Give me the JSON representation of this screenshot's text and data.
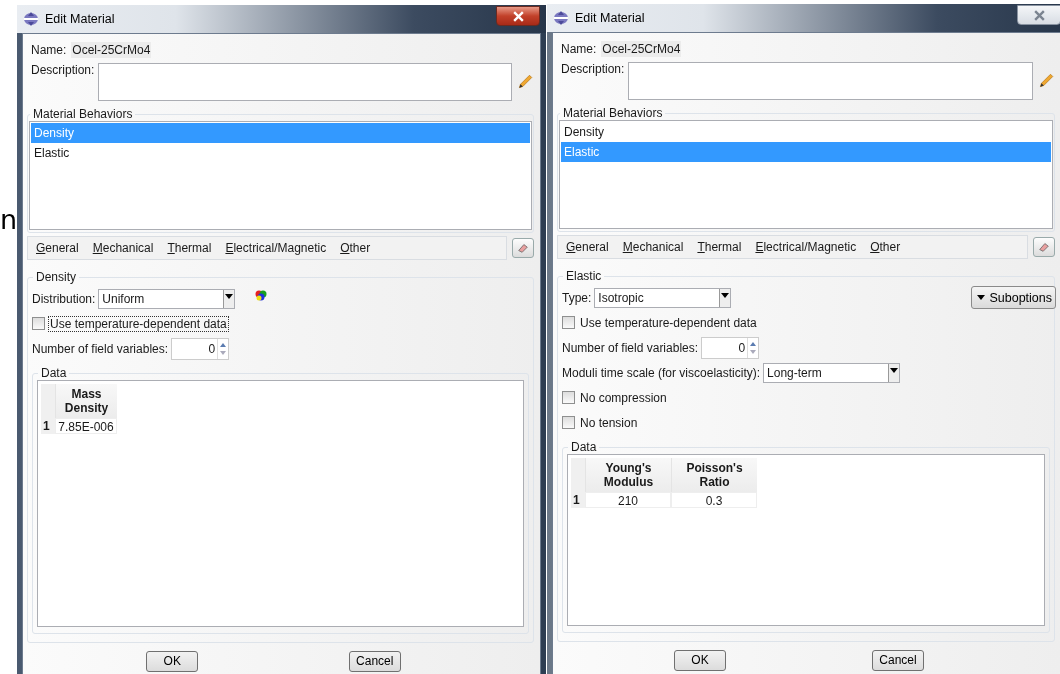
{
  "background_text": "n",
  "dialogs": [
    {
      "title": "Edit Material",
      "focused": true,
      "name_label": "Name:",
      "name_value": "Ocel-25CrMo4",
      "description_label": "Description:",
      "behaviors": {
        "title": "Material Behaviors",
        "items": [
          {
            "label": "Density",
            "selected": true
          },
          {
            "label": "Elastic",
            "selected": false
          }
        ]
      },
      "menus": [
        "General",
        "Mechanical",
        "Thermal",
        "Electrical/Magnetic",
        "Other"
      ],
      "section": {
        "title": "Density",
        "rows": [
          {
            "kind": "select",
            "label": "Distribution:",
            "value": "Uniform",
            "palette_icon": true
          },
          {
            "kind": "checkbox",
            "label": "Use temperature-dependent data",
            "checked": false,
            "focused": true
          },
          {
            "kind": "spinner",
            "label": "Number of field variables:",
            "value": "0"
          }
        ]
      },
      "data": {
        "title": "Data",
        "columns": [
          "Mass Density"
        ],
        "rows": [
          {
            "index": "1",
            "cells": [
              "7.85E-006"
            ]
          }
        ]
      },
      "buttons": [
        "OK",
        "Cancel"
      ]
    },
    {
      "title": "Edit Material",
      "focused": false,
      "name_label": "Name:",
      "name_value": "Ocel-25CrMo4",
      "description_label": "Description:",
      "behaviors": {
        "title": "Material Behaviors",
        "items": [
          {
            "label": "Density",
            "selected": false
          },
          {
            "label": "Elastic",
            "selected": true
          }
        ]
      },
      "menus": [
        "General",
        "Mechanical",
        "Thermal",
        "Electrical/Magnetic",
        "Other"
      ],
      "section": {
        "title": "Elastic",
        "rows": [
          {
            "kind": "select",
            "label": "Type:",
            "value": "Isotropic",
            "button": "Suboptions"
          },
          {
            "kind": "checkbox",
            "label": "Use temperature-dependent data",
            "checked": false,
            "focused": false
          },
          {
            "kind": "spinner",
            "label": "Number of field variables:",
            "value": "0"
          },
          {
            "kind": "select",
            "label": "Moduli time scale (for viscoelasticity):",
            "value": "Long-term"
          },
          {
            "kind": "checkbox",
            "label": "No compression",
            "checked": false,
            "focused": false
          },
          {
            "kind": "checkbox",
            "label": "No tension",
            "checked": false,
            "focused": false
          }
        ]
      },
      "data": {
        "title": "Data",
        "columns": [
          "Young's Modulus",
          "Poisson's Ratio"
        ],
        "rows": [
          {
            "index": "1",
            "cells": [
              "210",
              "0.3"
            ]
          }
        ]
      },
      "buttons": [
        "OK",
        "Cancel"
      ]
    }
  ]
}
